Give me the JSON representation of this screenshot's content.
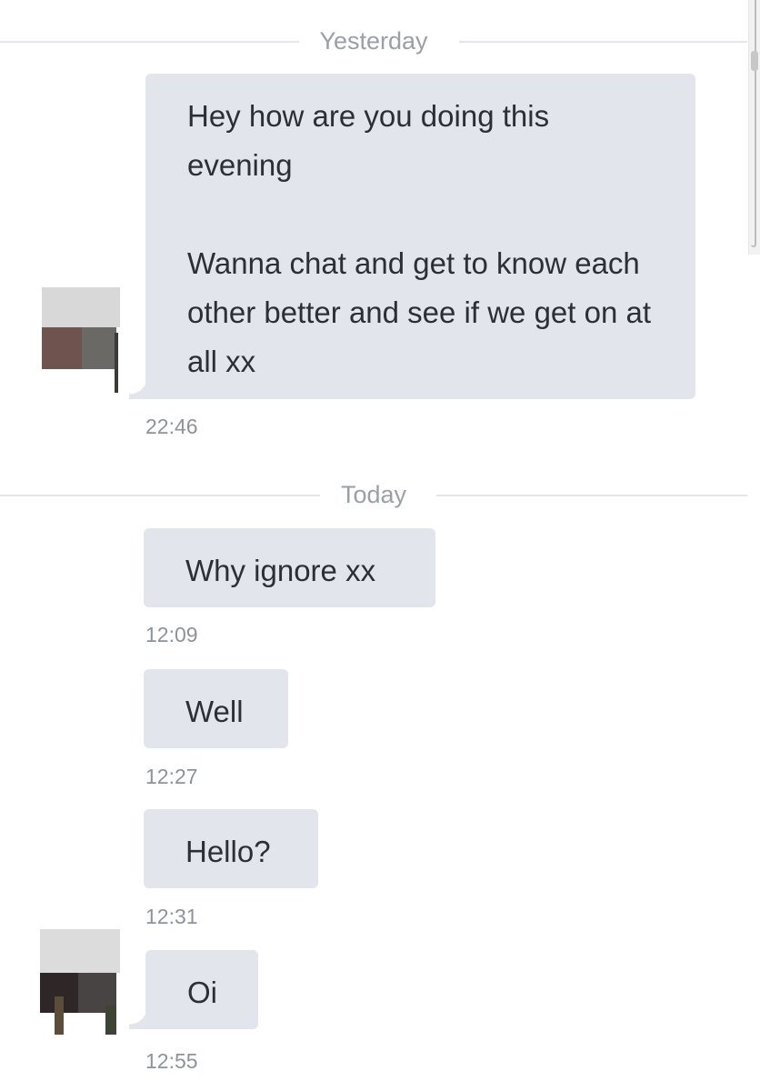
{
  "dividers": {
    "yesterday": "Yesterday",
    "today": "Today"
  },
  "messages": [
    {
      "text": "Hey how are you doing this evening\n\nWanna chat and get to know each other better and see if we get on at all xx",
      "time": "22:46"
    },
    {
      "text": "Why ignore xx",
      "time": "12:09"
    },
    {
      "text": "Well",
      "time": "12:27"
    },
    {
      "text": "Hello?",
      "time": "12:31"
    },
    {
      "text": "Oi",
      "time": "12:55"
    }
  ],
  "colors": {
    "bubble": "#e3e5ec",
    "text": "#2b2f38",
    "timestamp": "#8d939c",
    "divider_line": "#e4e6eb"
  }
}
